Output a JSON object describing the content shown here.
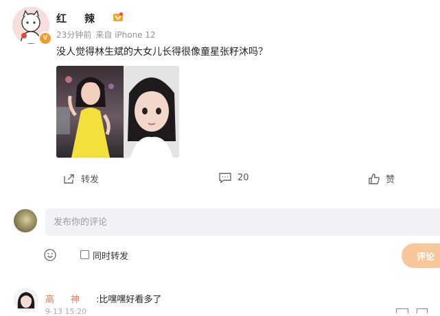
{
  "post": {
    "username": "红辣",
    "meta_time": "23分钟前",
    "meta_source": "来自 iPhone 12",
    "text": "没人觉得林生斌的大女儿长得很像童星张籽沐吗？",
    "avatar_icon": "cartoon-avatar",
    "verified_badge": "V"
  },
  "actions": {
    "repost_label": "转发",
    "comment_count": "20",
    "like_label": "赞"
  },
  "composer": {
    "placeholder": "发布你的评论",
    "repost_checkbox_label": "同时转发",
    "submit_label": "评论"
  },
  "reply": {
    "name": "高神",
    "separator": ":",
    "text": "比嘿嘿好看多了",
    "time": "9-13 15:20"
  },
  "colors": {
    "accent_orange": "#eb7350",
    "submit_bg": "#f7c79b",
    "input_bg": "#f1f2f5"
  }
}
